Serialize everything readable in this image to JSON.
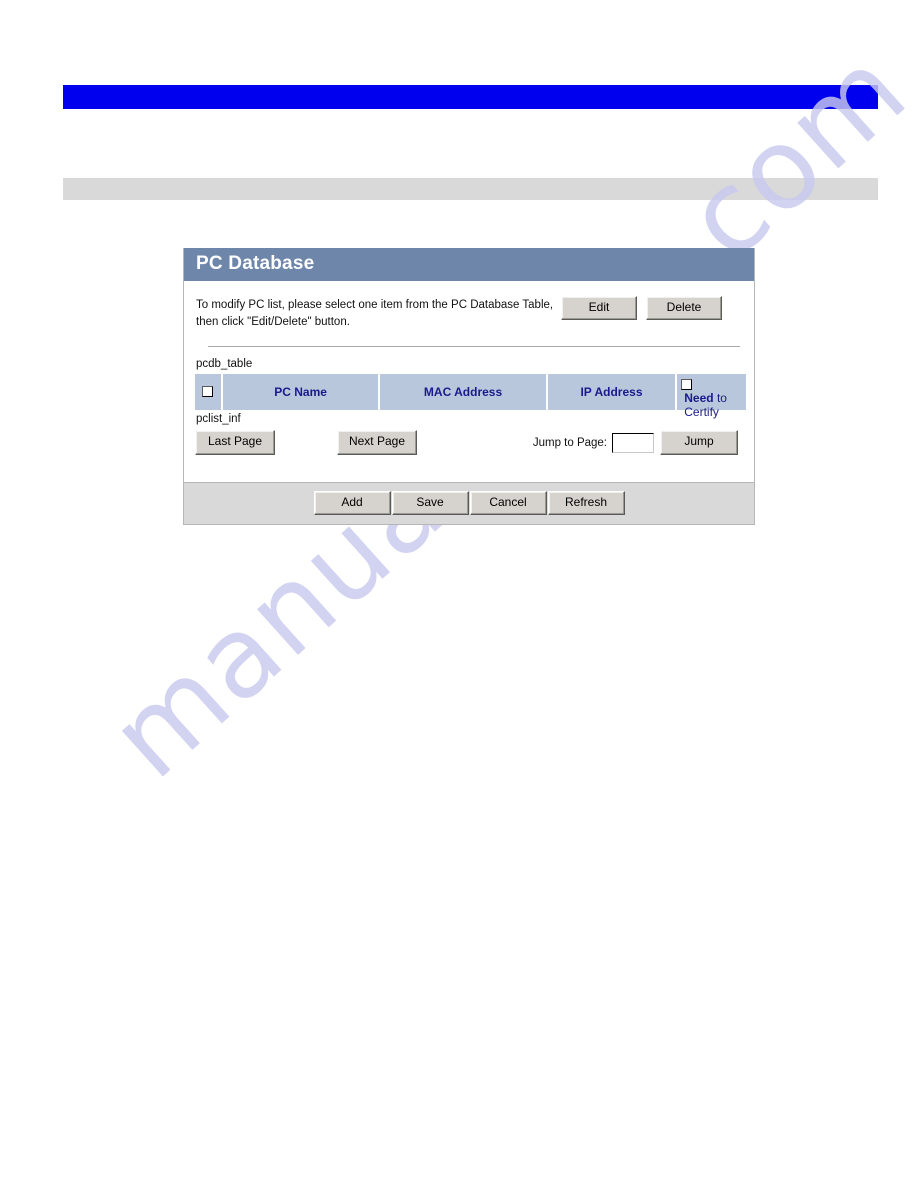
{
  "watermark": {
    "text": "manualshive.com"
  },
  "topbars": {
    "blue_color": "#0000ee",
    "gray_color": "#d9d9d9"
  },
  "panel": {
    "title": "PC Database",
    "title_bg": "#6e86aa",
    "instruction": "To modify PC list, please select one item from the PC Database Table, then click \"Edit/Delete\" button.",
    "actions": {
      "edit_label": "Edit",
      "delete_label": "Delete"
    },
    "table": {
      "label": "pcdb_table",
      "header_bg": "#b9c7dc",
      "header_text_color": "#1a1a8c",
      "columns": [
        {
          "key": "select",
          "label": ""
        },
        {
          "key": "pc_name",
          "label": "PC Name"
        },
        {
          "key": "mac_address",
          "label": "MAC Address"
        },
        {
          "key": "ip_address",
          "label": "IP Address"
        },
        {
          "key": "need_to_certify",
          "label_bold": "Need",
          "label_rest": "to Certify"
        }
      ],
      "rows": []
    },
    "pager": {
      "label": "pclist_inf",
      "last_page_label": "Last Page",
      "next_page_label": "Next Page",
      "jump_to_page_label": "Jump to Page:",
      "jump_input_value": "",
      "jump_input_placeholder": "",
      "jump_label": "Jump"
    },
    "footer": {
      "add_label": "Add",
      "save_label": "Save",
      "cancel_label": "Cancel",
      "refresh_label": "Refresh"
    }
  }
}
